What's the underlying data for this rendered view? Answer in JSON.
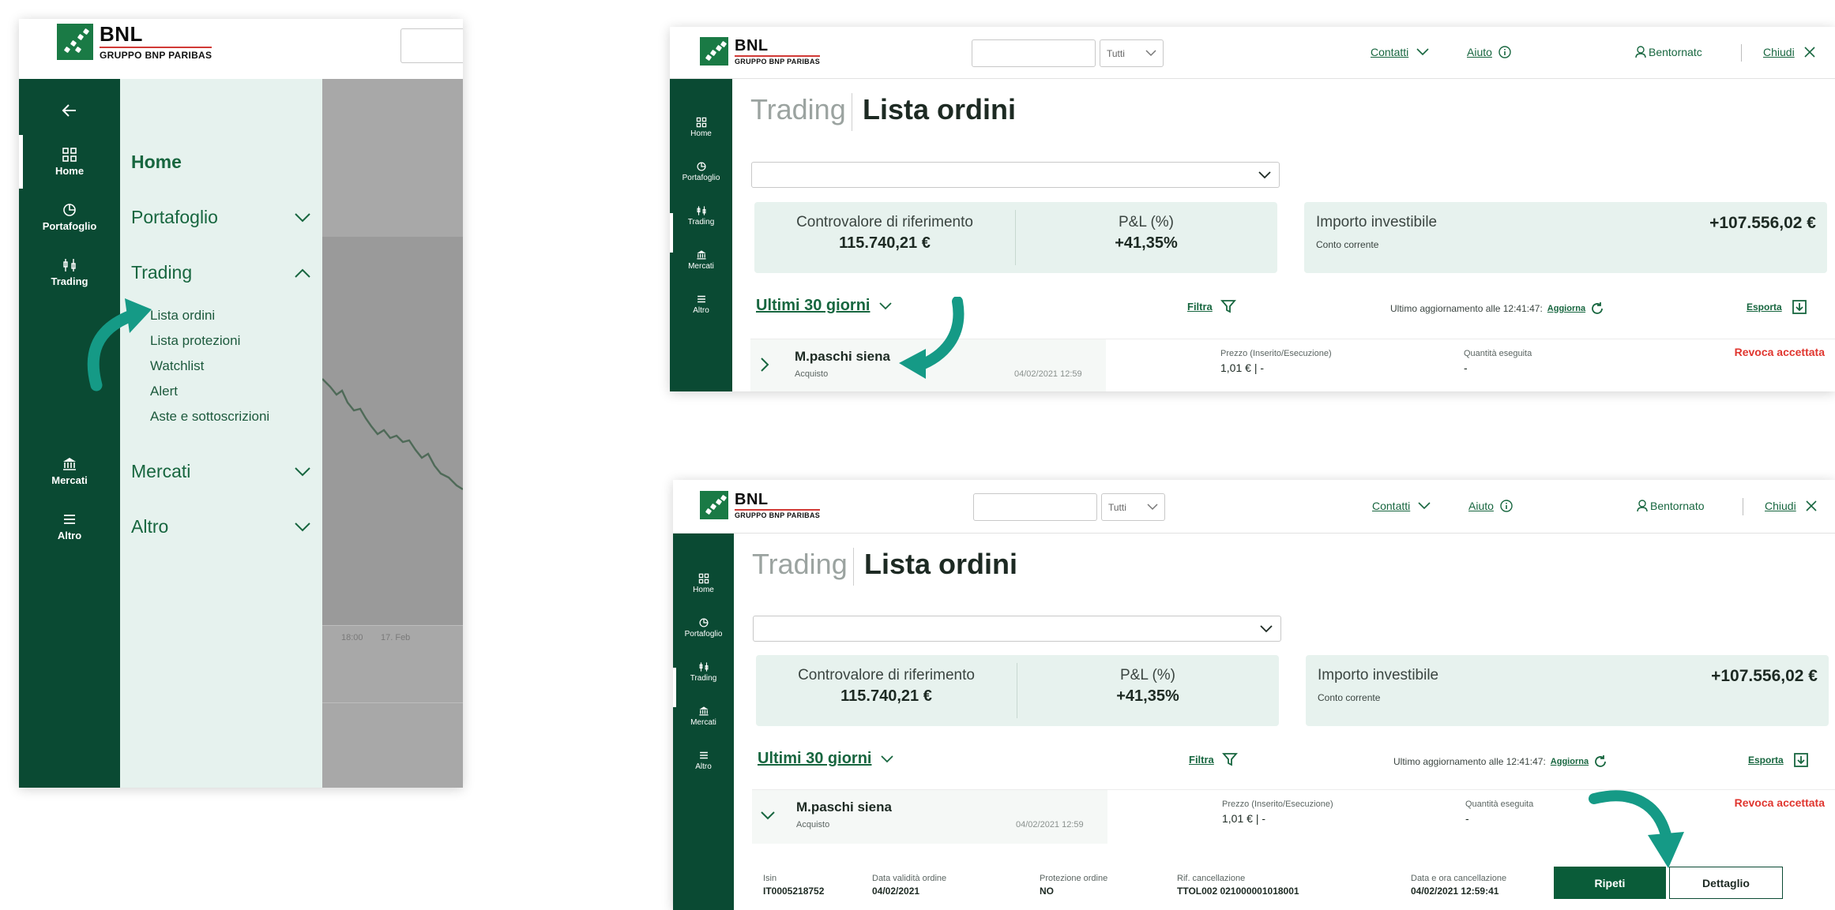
{
  "brand": {
    "name": "BNL",
    "group": "GRUPPO BNP PARIBAS"
  },
  "colors": {
    "primary_green": "#0a4a33",
    "accent_teal": "#159a86",
    "light_green": "#e6f2ee",
    "red": "#e0362f"
  },
  "left_menu": {
    "rail": {
      "home": "Home",
      "portfolio": "Portafoglio",
      "trading": "Trading",
      "markets": "Mercati",
      "other": "Altro"
    },
    "items": {
      "home": "Home",
      "portfolio": "Portafoglio",
      "trading": "Trading",
      "markets": "Mercati",
      "other": "Altro"
    },
    "trading_sub": [
      "Lista ordini",
      "Lista protezioni",
      "Watchlist",
      "Alert",
      "Aste e sottoscrizioni"
    ],
    "chart_ticks": [
      "18:00",
      "17. Feb"
    ]
  },
  "header": {
    "filter_select": "Tutti",
    "contacts": "Contatti",
    "help": "Aiuto",
    "user_top": "Bentornatc",
    "user_bottom": "Bentornato",
    "close": "Chiudi"
  },
  "page": {
    "section": "Trading",
    "title": "Lista ordini"
  },
  "kpis": {
    "ref_label": "Controvalore di riferimento",
    "ref_value": "115.740,21 €",
    "pnl_label": "P&L (%)",
    "pnl_value": "+41,35%",
    "invest_label": "Importo investibile",
    "invest_sub": "Conto corrente",
    "invest_value": "+107.556,02 €"
  },
  "toolbar": {
    "period": "Ultimi 30 giorni",
    "filter": "Filtra",
    "updated": "Ultimo aggiornamento alle 12:41:47:",
    "refresh": "Aggiorna",
    "export": "Esporta"
  },
  "order": {
    "name": "M.paschi siena",
    "side": "Acquisto",
    "date": "04/02/2021 12:59",
    "price_label": "Prezzo (Inserito/Esecuzione)",
    "price_value": "1,01 € | -",
    "qty_label": "Quantità eseguita",
    "qty_value": "-",
    "status": "Revoca accettata"
  },
  "order_detail": {
    "isin_label": "Isin",
    "isin_value": "IT0005218752",
    "validity_label": "Data validità ordine",
    "validity_value": "04/02/2021",
    "protection_label": "Protezione ordine",
    "protection_value": "NO",
    "cancel_ref_label": "Rif. cancellazione",
    "cancel_ref_value": "TTOL002 021000001018001",
    "cancel_date_label": "Data e ora cancellazione",
    "cancel_date_value": "04/02/2021 12:59:41",
    "repeat_button": "Ripeti",
    "detail_button": "Dettaglio"
  }
}
